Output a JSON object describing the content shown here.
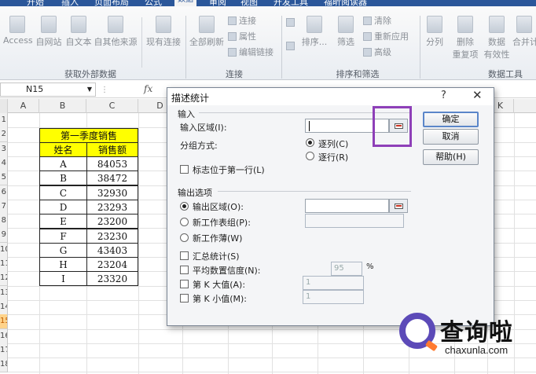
{
  "ribbon": {
    "tabs": [
      "开始",
      "插入",
      "页面布局",
      "公式",
      "数据",
      "审阅",
      "视图",
      "开发工具",
      "福昕阅读器"
    ],
    "active_tab": "数据",
    "external": {
      "access": "Access",
      "web": "自网站",
      "text": "自文本",
      "other": "自其他来源",
      "existing": "现有连接",
      "group": "获取外部数据"
    },
    "connections": {
      "refresh": "全部刷新",
      "connect": "连接",
      "props": "属性",
      "edit_links": "编辑链接",
      "group": "连接"
    },
    "sortfilter": {
      "sort": "排序...",
      "filter": "筛选",
      "clear": "清除",
      "reapply": "重新应用",
      "advanced": "高级",
      "group": "排序和筛选"
    },
    "tools": {
      "split": "分列",
      "remove_dup_1": "删除",
      "remove_dup_2": "重复项",
      "validation_1": "数据",
      "validation_2": "有效性",
      "merge": "合并计",
      "group": "数据工具"
    }
  },
  "formula_bar": {
    "name_box": "N15",
    "fx": "fx"
  },
  "sheet": {
    "columns": [
      "A",
      "B",
      "C",
      "D",
      "K"
    ],
    "rows": [
      "1",
      "2",
      "3",
      "4",
      "5",
      "6",
      "7",
      "8",
      "9",
      "10",
      "11",
      "12",
      "13",
      "14",
      "15",
      "16",
      "17",
      "18"
    ],
    "selected_row": "15",
    "table": {
      "title": "第一季度销售",
      "header_name": "姓名",
      "header_sales": "销售额",
      "rows": [
        {
          "name": "A",
          "value": "84053"
        },
        {
          "name": "B",
          "value": "38472"
        },
        {
          "name": "C",
          "value": "32930"
        },
        {
          "name": "D",
          "value": "23293"
        },
        {
          "name": "E",
          "value": "23200"
        },
        {
          "name": "F",
          "value": "23230"
        },
        {
          "name": "G",
          "value": "43403"
        },
        {
          "name": "H",
          "value": "23204"
        },
        {
          "name": "I",
          "value": "23320"
        }
      ]
    }
  },
  "dialog": {
    "title": "描述统计",
    "help_glyph": "?",
    "close_glyph": "✕",
    "input_group": "输入",
    "input_range_label": "输入区域(I):",
    "input_range_value": "",
    "grouping_label": "分组方式:",
    "by_column": "逐列(C)",
    "by_row": "逐行(R)",
    "labels_first_row": "标志位于第一行(L)",
    "output_group": "输出选项",
    "output_range": "输出区域(O):",
    "new_sheet": "新工作表组(P):",
    "new_workbook": "新工作薄(W)",
    "summary_stats": "汇总统计(S)",
    "confidence_level": "平均数置信度(N):",
    "confidence_value": "95",
    "percent": "%",
    "kth_largest": "第 K 大值(A):",
    "kth_largest_value": "1",
    "kth_smallest": "第 K 小值(M):",
    "kth_smallest_value": "1",
    "ok": "确定",
    "cancel": "取消",
    "help": "帮助(H)"
  },
  "watermark": {
    "brand": "查询啦",
    "url": "chaxunla.com",
    "accent": "#5c4ab8"
  }
}
